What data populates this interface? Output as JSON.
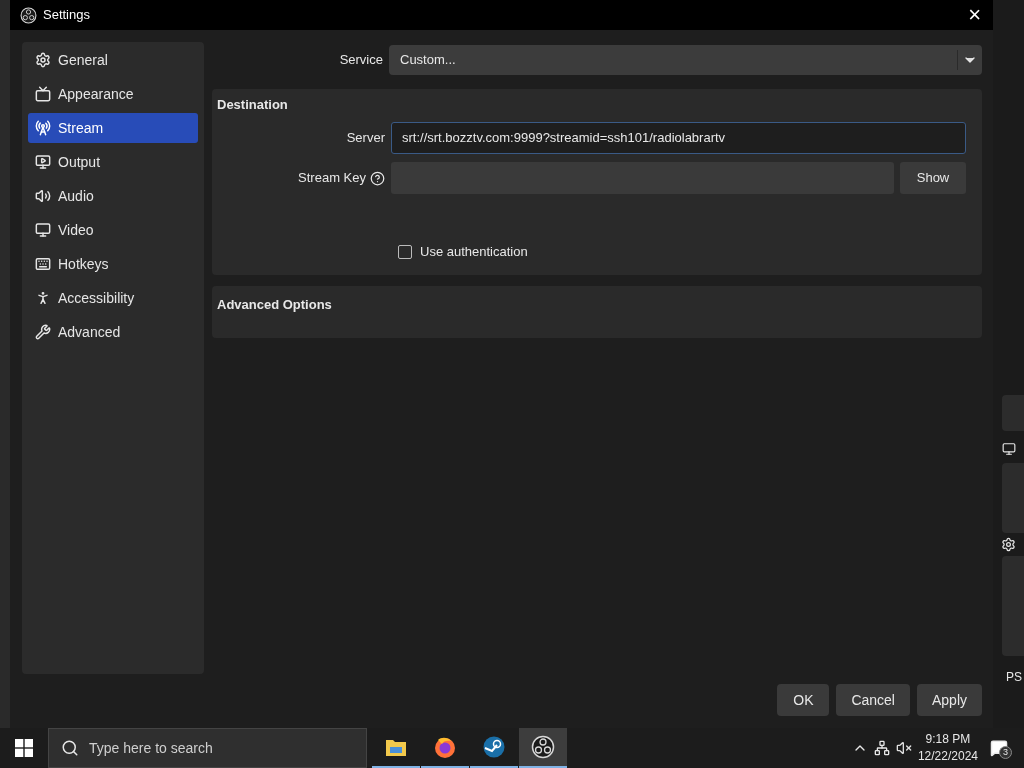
{
  "dialog": {
    "title": "Settings",
    "close": "×"
  },
  "sidebar": {
    "items": [
      {
        "label": "General",
        "selected": false
      },
      {
        "label": "Appearance",
        "selected": false
      },
      {
        "label": "Stream",
        "selected": true
      },
      {
        "label": "Output",
        "selected": false
      },
      {
        "label": "Audio",
        "selected": false
      },
      {
        "label": "Video",
        "selected": false
      },
      {
        "label": "Hotkeys",
        "selected": false
      },
      {
        "label": "Accessibility",
        "selected": false
      },
      {
        "label": "Advanced",
        "selected": false
      }
    ]
  },
  "service": {
    "label": "Service",
    "value": "Custom..."
  },
  "destination": {
    "title": "Destination",
    "server_label": "Server",
    "server_value": "srt://srt.bozztv.com:9999?streamid=ssh101/radiolabrartv",
    "stream_key_label": "Stream Key",
    "show_button": "Show",
    "use_authentication": {
      "label": "Use authentication",
      "checked": false
    }
  },
  "advanced_options": {
    "title": "Advanced Options"
  },
  "buttons": [
    "OK",
    "Cancel",
    "Apply"
  ],
  "background_window": {
    "status_text": "PS"
  },
  "taskbar": {
    "search_placeholder": "Type here to search",
    "apps": [
      {
        "selected": false
      },
      {
        "selected": false
      },
      {
        "selected": false
      },
      {
        "selected": true
      }
    ],
    "time": "9:18 PM",
    "date": "12/22/2024",
    "notifications": "3"
  }
}
